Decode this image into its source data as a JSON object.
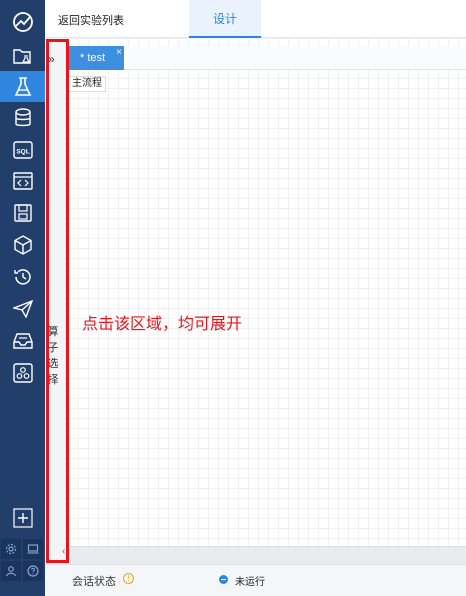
{
  "header": {
    "back_label": "返回实验列表",
    "active_tab": "设计"
  },
  "nav": {
    "items": [
      {
        "icon": "dashboard-icon",
        "active": false
      },
      {
        "icon": "folder-flask-icon",
        "active": false
      },
      {
        "icon": "flask-icon",
        "active": true
      },
      {
        "icon": "database-icon",
        "active": false
      },
      {
        "icon": "sql-icon",
        "active": false
      },
      {
        "icon": "code-window-icon",
        "active": false
      },
      {
        "icon": "save-disk-icon",
        "active": false
      },
      {
        "icon": "cube-icon",
        "active": false
      },
      {
        "icon": "history-icon",
        "active": false
      },
      {
        "icon": "send-icon",
        "active": false
      },
      {
        "icon": "inbox-icon",
        "active": false
      },
      {
        "icon": "cluster-icon",
        "active": false
      }
    ],
    "sql_text": "SQL",
    "add_icon": "plus-icon",
    "bottom_icons": [
      "settings-icon",
      "monitor-icon",
      "user-icon",
      "help-icon"
    ]
  },
  "side_panel": {
    "expand_glyph": "»",
    "vertical_label": "算子选择",
    "collapse_glyph": "‹"
  },
  "editor": {
    "file_tab": "* test",
    "file_tab_close": "×",
    "flow_label": "主流程"
  },
  "annotation": "点击该区域，均可展开",
  "footer": {
    "session_label": "会话状态",
    "info_glyph": "!",
    "status_text": "未运行"
  },
  "colors": {
    "nav_bg": "#223f6c",
    "accent": "#2e86de",
    "annotation": "#e8141b",
    "warning": "#f0a500"
  }
}
